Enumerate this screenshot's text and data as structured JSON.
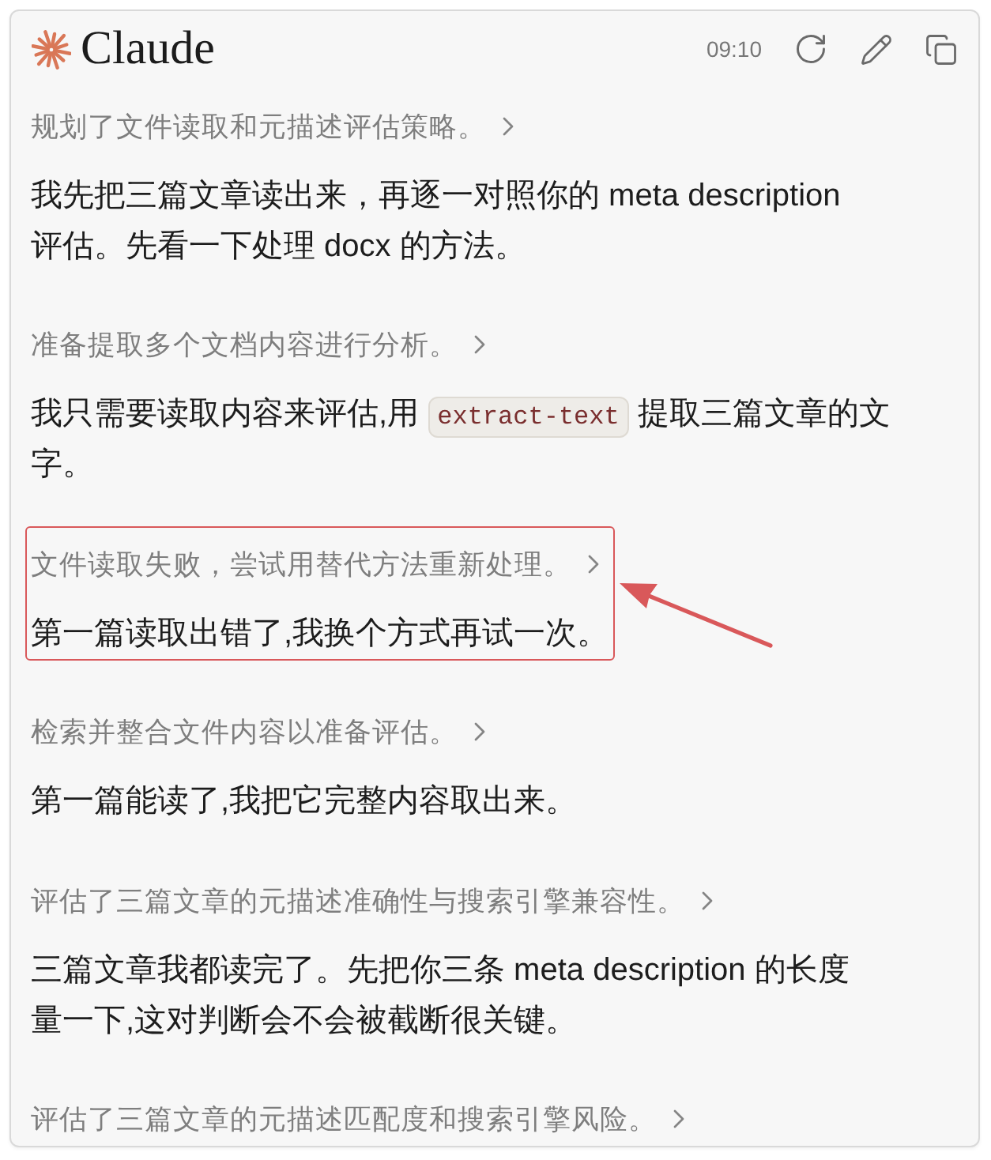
{
  "header": {
    "logo": "Claude",
    "time": "09:10"
  },
  "steps": [
    {
      "summary": "规划了文件读取和元描述评估策略。",
      "highlighted": false,
      "reply": [
        [
          {
            "kind": "text",
            "text": "我先把三篇文章读出来，再逐一对照你的 meta description"
          }
        ],
        [
          {
            "kind": "text",
            "text": "评估。先看一下处理 docx 的方法。"
          }
        ]
      ]
    },
    {
      "summary": "准备提取多个文档内容进行分析。",
      "highlighted": false,
      "reply": [
        [
          {
            "kind": "text",
            "text": "我只需要读取内容来评估,用 "
          },
          {
            "kind": "code",
            "text": "extract-text"
          },
          {
            "kind": "text",
            "text": " 提取三篇文章的文"
          }
        ],
        [
          {
            "kind": "text",
            "text": "字。"
          }
        ]
      ]
    },
    {
      "summary": "文件读取失败，尝试用替代方法重新处理。",
      "highlighted": true,
      "reply": [
        [
          {
            "kind": "text",
            "text": "第一篇读取出错了,我换个方式再试一次。"
          }
        ]
      ]
    },
    {
      "summary": "检索并整合文件内容以准备评估。",
      "highlighted": false,
      "reply": [
        [
          {
            "kind": "text",
            "text": "第一篇能读了,我把它完整内容取出来。"
          }
        ]
      ]
    },
    {
      "summary": "评估了三篇文章的元描述准确性与搜索引擎兼容性。",
      "highlighted": false,
      "reply": [
        [
          {
            "kind": "text",
            "text": "三篇文章我都读完了。先把你三条 meta description 的长度"
          }
        ],
        [
          {
            "kind": "text",
            "text": "量一下,这对判断会不会被截断很关键。"
          }
        ]
      ]
    },
    {
      "summary": "评估了三篇文章的元描述匹配度和搜索引擎风险。",
      "highlighted": false
    }
  ]
}
